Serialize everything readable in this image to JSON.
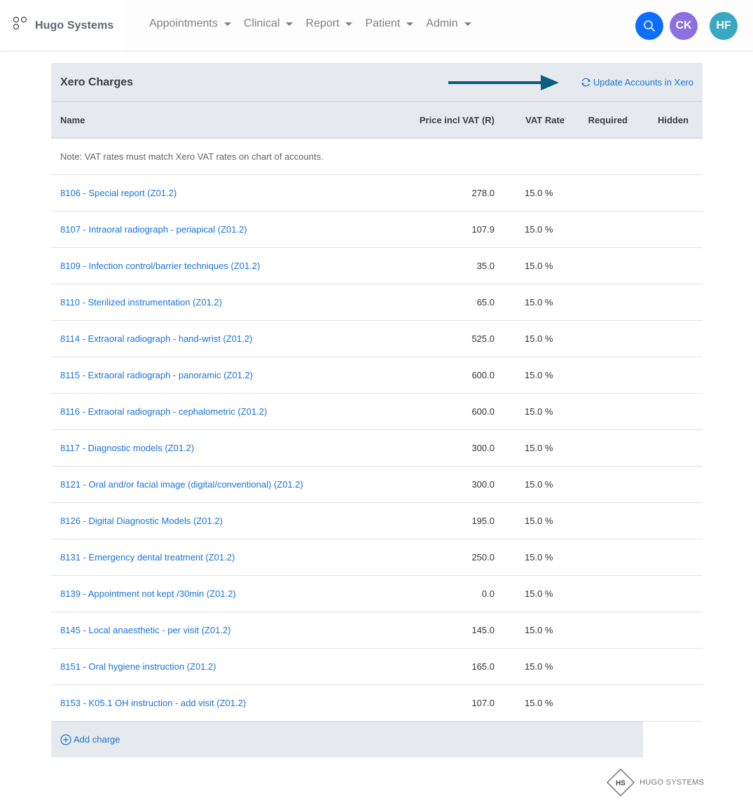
{
  "navbar": {
    "brand": "Hugo Systems",
    "menu": [
      {
        "label": "Appointments"
      },
      {
        "label": "Clinical"
      },
      {
        "label": "Report"
      },
      {
        "label": "Patient"
      },
      {
        "label": "Admin"
      }
    ],
    "search_icon": "search-icon",
    "avatars": [
      {
        "initials": "CK",
        "color": "#8c6fe0"
      },
      {
        "initials": "HF",
        "color": "#3aa8c1"
      }
    ]
  },
  "card": {
    "title": "Xero Charges",
    "update_label": "Update Accounts in Xero",
    "columns": {
      "name": "Name",
      "price": "Price incl VAT (R)",
      "vat": "VAT Rate",
      "required": "Required",
      "hidden": "Hidden"
    },
    "note": "Note: VAT rates must match Xero VAT rates on chart of accounts.",
    "rows": [
      {
        "name": "8106 - Special report (Z01.2)",
        "price": "278.0",
        "vat": "15.0 %"
      },
      {
        "name": "8107 - Intraoral radiograph - periapical (Z01.2)",
        "price": "107.9",
        "vat": "15.0 %"
      },
      {
        "name": "8109 - Infection control/barrier techniques (Z01.2)",
        "price": "35.0",
        "vat": "15.0 %"
      },
      {
        "name": "8110 - Sterilized instrumentation (Z01.2)",
        "price": "65.0",
        "vat": "15.0 %"
      },
      {
        "name": "8114 - Extraoral radiograph - hand-wrist (Z01.2)",
        "price": "525.0",
        "vat": "15.0 %"
      },
      {
        "name": "8115 - Extraoral radiograph - panoramic (Z01.2)",
        "price": "600.0",
        "vat": "15.0 %"
      },
      {
        "name": "8116 - Extraoral radiograph - cephalometric (Z01.2)",
        "price": "600.0",
        "vat": "15.0 %"
      },
      {
        "name": "8117 - Diagnostic models (Z01.2)",
        "price": "300.0",
        "vat": "15.0 %"
      },
      {
        "name": "8121 - Oral and/or facial image (digital/conventional) (Z01.2)",
        "price": "300.0",
        "vat": "15.0 %"
      },
      {
        "name": "8126 - Digital Diagnostic Models (Z01.2)",
        "price": "195.0",
        "vat": "15.0 %"
      },
      {
        "name": "8131 - Emergency dental treatment (Z01.2)",
        "price": "250.0",
        "vat": "15.0 %"
      },
      {
        "name": "8139 - Appointment not kept /30min (Z01.2)",
        "price": "0.0",
        "vat": "15.0 %"
      },
      {
        "name": "8145 - Local anaesthetic - per visit (Z01.2)",
        "price": "145.0",
        "vat": "15.0 %"
      },
      {
        "name": "8151 - Oral hygiene instruction (Z01.2)",
        "price": "165.0",
        "vat": "15.0 %"
      },
      {
        "name": "8153 - K05.1 OH instruction - add visit (Z01.2)",
        "price": "107.0",
        "vat": "15.0 %"
      }
    ],
    "add_label": "Add charge"
  },
  "footer": {
    "logo_initials": "HS",
    "logo_text": "HUGO SYSTEMS"
  },
  "colors": {
    "link": "#1a73d9",
    "primary": "#0d6efd",
    "arrow": "#0b5f80",
    "header_bg": "#e6e9ed"
  }
}
